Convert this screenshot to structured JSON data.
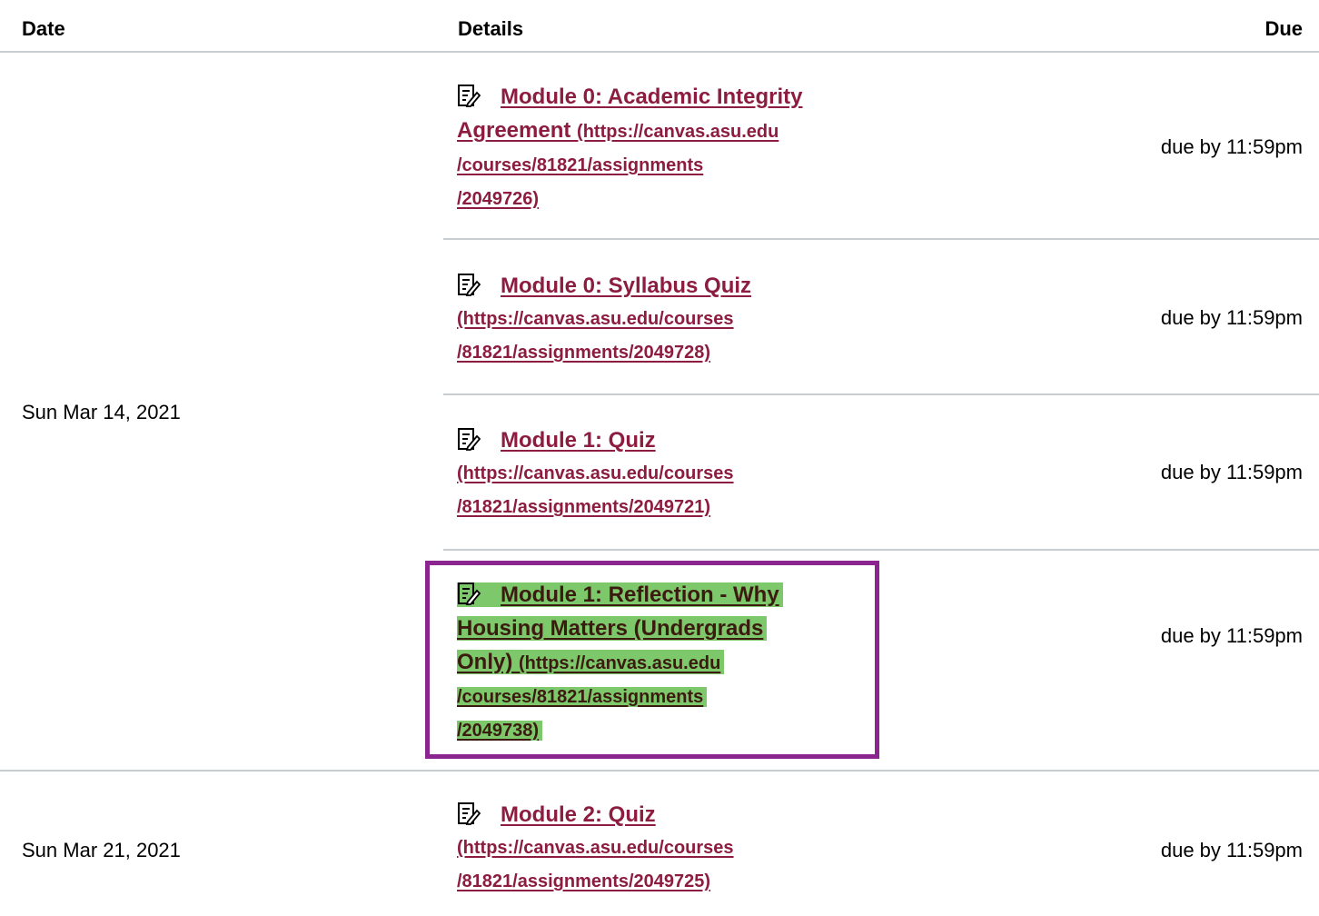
{
  "table": {
    "headers": {
      "date": "Date",
      "details": "Details",
      "due": "Due"
    },
    "groups": [
      {
        "date": "Sun Mar 14, 2021"
      },
      {
        "date": "Sun Mar 21, 2021"
      }
    ],
    "rows": [
      {
        "title_lines": [
          "Module 0: Academic Integrity",
          "Agreement "
        ],
        "url_lines": [
          "(https://canvas.asu.edu",
          "/courses/81821/assignments",
          "/2049726)"
        ],
        "due": "due by 11:59pm"
      },
      {
        "title_lines": [
          "Module 0: Syllabus Quiz"
        ],
        "url_lines": [
          "(https://canvas.asu.edu/courses",
          "/81821/assignments/2049728)"
        ],
        "due": "due by 11:59pm"
      },
      {
        "title_lines": [
          "Module 1: Quiz"
        ],
        "url_lines": [
          "(https://canvas.asu.edu/courses",
          "/81821/assignments/2049721)"
        ],
        "due": "due by 11:59pm"
      },
      {
        "title_lines": [
          "Module 1: Reflection - Why",
          "Housing Matters (Undergrads",
          "Only) "
        ],
        "url_lines": [
          "(https://canvas.asu.edu",
          "/courses/81821/assignments",
          "/2049738)"
        ],
        "due": "due by 11:59pm",
        "highlighted": true
      },
      {
        "title_lines": [
          "Module 2: Quiz"
        ],
        "url_lines": [
          "(https://canvas.asu.edu/courses",
          "/81821/assignments/2049725)"
        ],
        "due": "due by 11:59pm"
      }
    ]
  },
  "icons": {
    "assignment": "quiz-edit-icon"
  },
  "colors": {
    "link": "#8c1d40",
    "highlight": "#7cc86a",
    "focus_border": "#8b2690",
    "divider": "#c7cdd1"
  }
}
